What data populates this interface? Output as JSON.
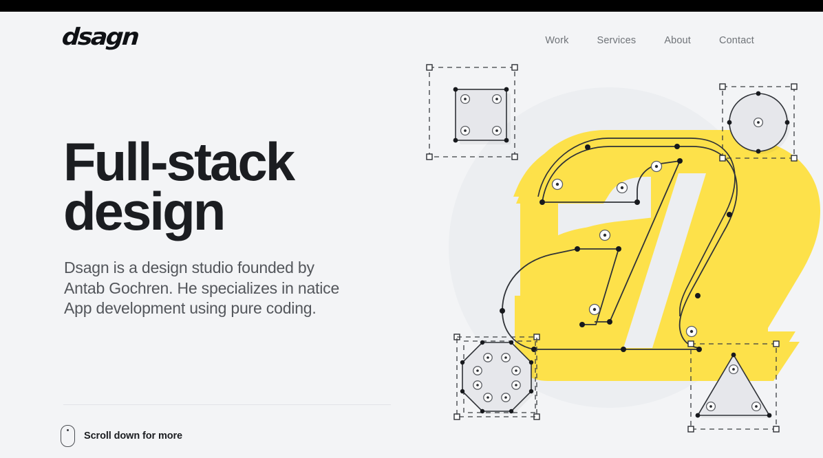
{
  "window": {
    "background_color": "#f3f4f6",
    "topbar_color": "#000000"
  },
  "header": {
    "logo_text": "dsagn",
    "nav": [
      {
        "label": "Work"
      },
      {
        "label": "Services"
      },
      {
        "label": "About"
      },
      {
        "label": "Contact"
      }
    ]
  },
  "hero": {
    "title": "Full-stack\ndesign",
    "description": "Dsagn is a design studio founded by\nAntab Gochren. He specializes in natice\nApp development using pure coding.",
    "scroll_hint_label": "Scroll down for more",
    "scroll_hint_icon": "mouse-icon"
  },
  "artwork": {
    "accent_color": "#FDE14A",
    "backdrop_circle_color": "#eceef1",
    "letterform": "a",
    "vector_path_stroke": "#2f3237",
    "shapes": [
      {
        "name": "square",
        "position": "top-left",
        "anchors": 4,
        "handles": 4
      },
      {
        "name": "circle",
        "position": "top-right",
        "anchors": 4,
        "handles": 1
      },
      {
        "name": "octagon",
        "position": "bottom-left",
        "anchors": 8,
        "handles": 8
      },
      {
        "name": "triangle",
        "position": "bottom-right",
        "anchors": 3,
        "handles": 3
      }
    ]
  },
  "colors": {
    "accent_yellow": "#FDE14A",
    "text_dark": "#1b1d21",
    "text_muted": "#53565b",
    "nav_gray": "#6f7378",
    "page_bg": "#f3f4f6",
    "shape_fill": "#e6e7eb"
  }
}
